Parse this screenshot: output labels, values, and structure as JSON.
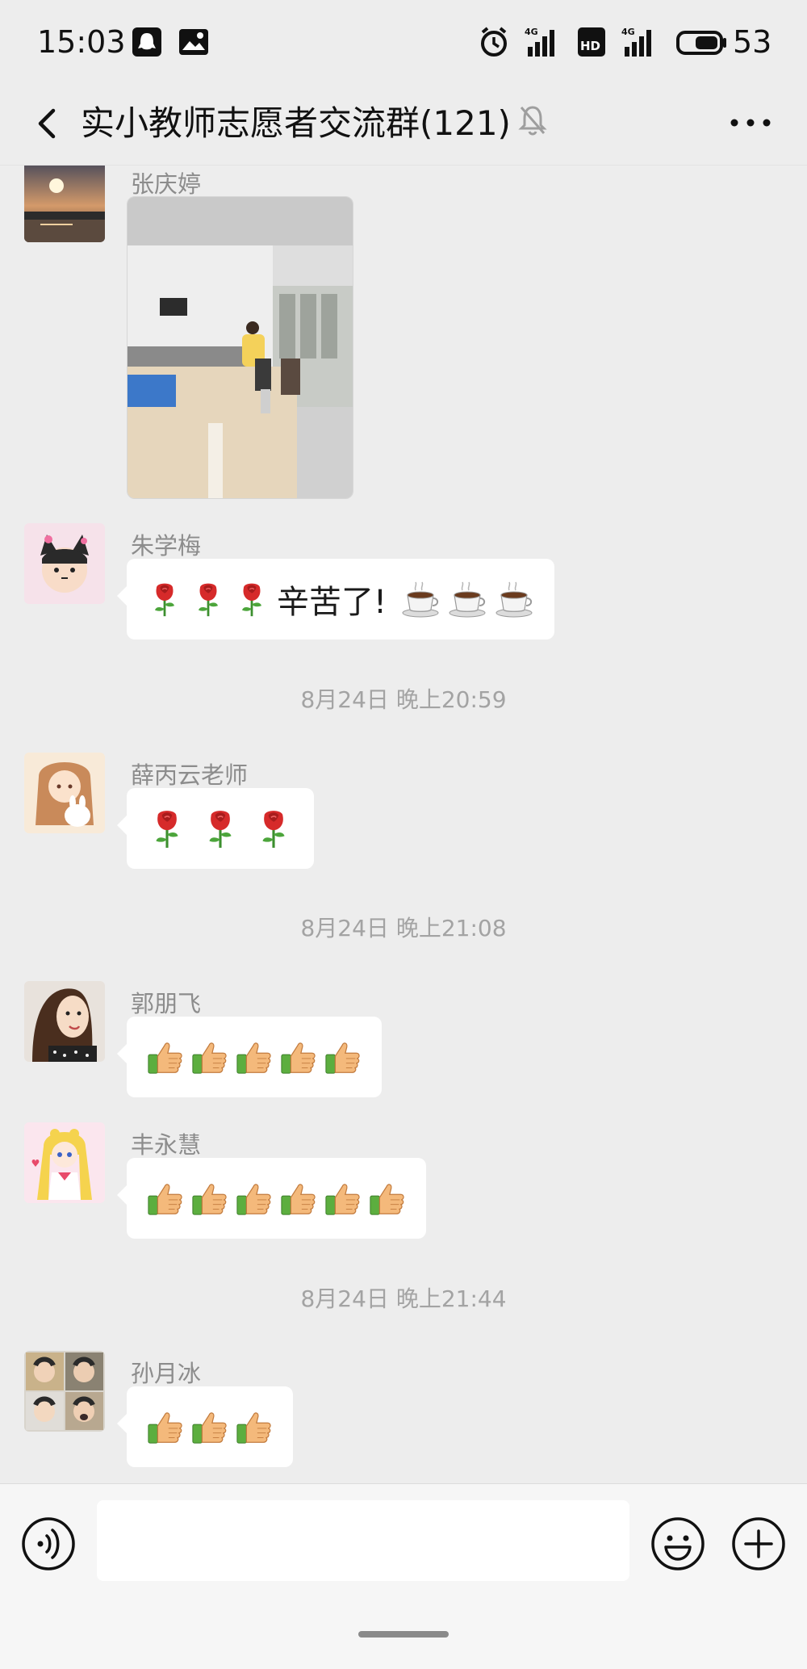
{
  "status_bar": {
    "time": "15:03",
    "network_1": "4G",
    "network_2": "HD",
    "network_3": "4G",
    "battery": "53"
  },
  "header": {
    "title": "实小教师志愿者交流群(121)"
  },
  "messages": [
    {
      "sender": "张庆婷",
      "type": "image"
    },
    {
      "sender": "朱学梅",
      "text": "辛苦了!",
      "emoji_before": [
        "rose-icon",
        "rose-icon",
        "rose-icon"
      ],
      "emoji_after": [
        "coffee-icon",
        "coffee-icon",
        "coffee-icon"
      ]
    },
    {
      "timestamp": "8月24日 晚上20:59"
    },
    {
      "sender": "薛丙云老师",
      "emoji": [
        "rose-icon",
        "rose-icon",
        "rose-icon"
      ]
    },
    {
      "timestamp": "8月24日 晚上21:08"
    },
    {
      "sender": "郭朋飞",
      "emoji": [
        "thumbs-up-icon",
        "thumbs-up-icon",
        "thumbs-up-icon",
        "thumbs-up-icon",
        "thumbs-up-icon"
      ]
    },
    {
      "sender": "丰永慧",
      "emoji": [
        "thumbs-up-icon",
        "thumbs-up-icon",
        "thumbs-up-icon",
        "thumbs-up-icon",
        "thumbs-up-icon",
        "thumbs-up-icon"
      ]
    },
    {
      "timestamp": "8月24日 晚上21:44"
    },
    {
      "sender": "孙月冰",
      "emoji": [
        "thumbs-up-icon",
        "thumbs-up-icon",
        "thumbs-up-icon"
      ]
    }
  ],
  "input": {
    "value": ""
  },
  "colors": {
    "background": "#ededed",
    "bubble": "#ffffff",
    "meta_text": "#8c8c8c",
    "rose": "#d62a2a",
    "thumb": "#f2b476",
    "sleeve": "#4fa83a"
  }
}
